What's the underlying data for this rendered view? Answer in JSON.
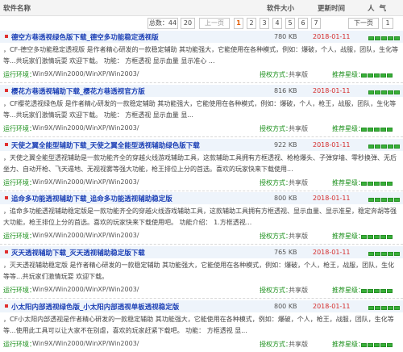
{
  "header": {
    "name_label": "软件名称",
    "size_label": "软件大小",
    "date_label": "更新时间",
    "pop_label": "人气"
  },
  "pager": {
    "total": "总数：44",
    "per_page": "20",
    "prev": "上一页",
    "pages": [
      "1",
      "2",
      "3",
      "4",
      "5",
      "6",
      "7"
    ],
    "active": "1",
    "next": "下一页",
    "jump": "1"
  },
  "items": [
    {
      "title": "德空方巷透视绿色版下载_德空多功能稳定透视版",
      "size": "780 KB",
      "date": "2018-01-11",
      "desc": "，CF-德空多功能稳定透视版 是作者精心研发的一款稳定辅助 其功能强大，它能使用在各种模式，例如：爆破，个人，战服，团队，生化等等...共玩家们激情玩耍 欢迎下载。 功能： 方框透视 显示血量 显示准心 ...",
      "env_label": "运行环境：",
      "env": "Win9X/Win2000/WinXP/Win2003/",
      "auth_label": "授权方式：",
      "auth": "共享版",
      "rec_label": "推荐星级：",
      "stars": 5
    },
    {
      "title": "樱花方巷透视辅助下载_樱花方巷透视官方版",
      "size": "816 KB",
      "date": "2018-01-11",
      "desc": "，CF樱花透视绿色版 是作者精心研发的一款稳定辅助 其功能强大，它能使用在各种模式，例如：爆破，个人，枪王，战服，团队，生化等等...共玩家们激情玩耍 欢迎下载。 功能： 方框透视 显示血量 显...",
      "env_label": "运行环境：",
      "env": "Win9X/Win2000/WinXP/Win2003/",
      "auth_label": "授权方式：",
      "auth": "共享版",
      "rec_label": "推荐星级：",
      "stars": 5
    },
    {
      "title": "天使之翼全能型辅助下载_天使之翼全能型透视辅助绿色版下载",
      "size": "922 KB",
      "date": "2018-01-11",
      "desc": "，天使之翼全能型透视辅助是一款功能齐全的穿越火线游戏辅助工具，这款辅助工具拥有方框透视、枪枪爆头、子弹穿墙、零秒换弹、无后坐力、自动开枪、飞天遁地、无视视雾等强大功能，枪王排位上分的首选。喜欢的玩家快来下载使用...",
      "env_label": "运行环境：",
      "env": "Win9X/Win2000/WinXP/Win2003/",
      "auth_label": "授权方式：",
      "auth": "共享版",
      "rec_label": "推荐星级：",
      "stars": 5
    },
    {
      "title": "追命多功能透视辅助下载_追命多功能透视辅助稳定版",
      "size": "800 KB",
      "date": "2018-01-11",
      "desc": "，追命多功能透视辅助稳定版是一款功能齐全的穿越火线游戏辅助工具，这款辅助工具拥有方框透视、显示血量、显示准星，稳定奔胡等强大功能，枪王排位上分的首选。喜欢的玩家快来下载使用吧。 功能介绍： 1.方框透视...",
      "env_label": "运行环境：",
      "env": "Win9X/Win2000/WinXP/Win2003/",
      "auth_label": "授权方式：",
      "auth": "共享版",
      "rec_label": "推荐星级：",
      "stars": 5
    },
    {
      "title": "灭天透视辅助下载_灭天透视辅助稳定版下载",
      "size": "765 KB",
      "date": "2018-01-11",
      "desc": "，灭天透视辅助稳定版 是作者精心研发的一款稳定辅助 其功能强大，它能使用在各种模式，例如：爆破，个人，枪王，战服，团队，生化等等...共玩家们激情玩耍 欢迎下载。",
      "env_label": "运行环境：",
      "env": "Win9X/Win2000/WinXP/Win2003/",
      "auth_label": "授权方式：",
      "auth": "共享版",
      "rec_label": "推荐星级：",
      "stars": 5
    },
    {
      "title": "小太阳内部透视绿色版_小太阳内部透视单板透视稳定版",
      "size": "800 KB",
      "date": "2018-01-11",
      "desc": "，CF小太阳内部透视是作者精心研发的一款稳定辅助 其功能强大，它能使用在各种模式，例如：爆破，个人，枪王，战服，团队，生化等等...使用此工具可以让大家不在别虐，喜欢的玩家赶紧下载吧。 功能： 方框透视 显...",
      "env_label": "运行环境：",
      "env": "Win9X/Win2000/WinXP/Win2003/",
      "auth_label": "授权方式：",
      "auth": "共享版",
      "rec_label": "推荐星级：",
      "stars": 5
    }
  ]
}
